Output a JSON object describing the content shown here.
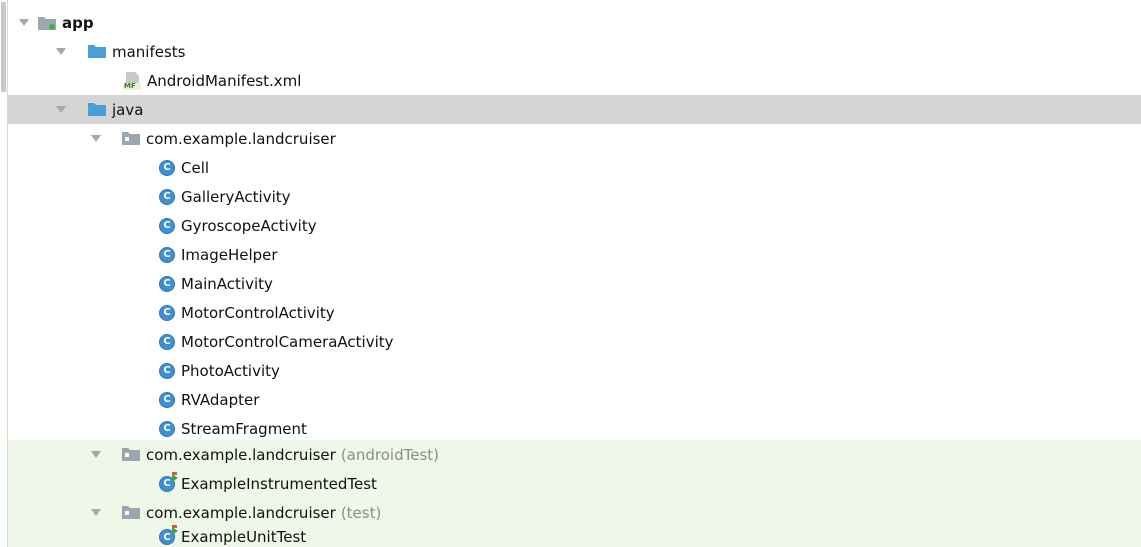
{
  "tree": {
    "app": "app",
    "manifests": "manifests",
    "manifest_file": "AndroidManifest.xml",
    "manifest_badge": "MF",
    "java": "java",
    "package_main": "com.example.landcruiser",
    "classes": [
      "Cell",
      "GalleryActivity",
      "GyroscopeActivity",
      "ImageHelper",
      "MainActivity",
      "MotorControlActivity",
      "MotorControlCameraActivity",
      "PhotoActivity",
      "RVAdapter",
      "StreamFragment"
    ],
    "class_icon_letter": "C",
    "package_android_test": "com.example.landcruiser",
    "android_test_suffix": "(androidTest)",
    "android_test_class": "ExampleInstrumentedTest",
    "package_test": "com.example.landcruiser",
    "test_suffix": "(test)",
    "test_class": "ExampleUnitTest"
  },
  "colors": {
    "selected_row": "#d5d5d5",
    "test_row": "#eff7e8",
    "folder_blue": "#4a9fd8",
    "package_gray": "#9aa6b0",
    "class_icon": "#3f8fd3",
    "secondary_text": "#8c8c8c"
  },
  "icons": {
    "module": "module-folder-icon",
    "folder": "folder-icon",
    "package": "package-icon",
    "manifest": "manifest-file-icon",
    "class": "java-class-icon",
    "test_class": "test-class-icon",
    "expand": "expand-arrow-icon"
  }
}
